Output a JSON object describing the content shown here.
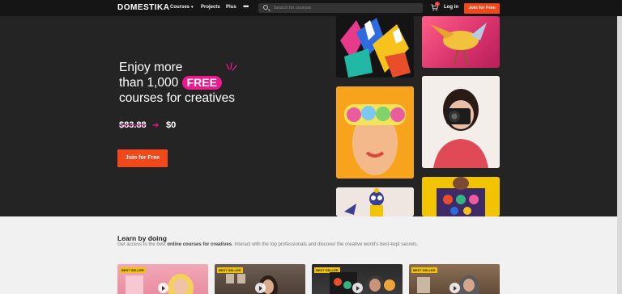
{
  "nav": {
    "logo": "DOMESTIKA",
    "courses_label": "Courses",
    "projects_label": "Projects",
    "plus_label": "Plus",
    "more_label": "•••",
    "search_placeholder": "Search for courses",
    "cart_count": "1",
    "login_label": "Log in",
    "join_label": "Join for Free"
  },
  "hero": {
    "headline_line1": "Enjoy more",
    "headline_line2_prefix": "than 1,000",
    "free_label": "FREE",
    "headline_line3": "courses for creatives",
    "price_old": "$83.88",
    "price_new": "$0",
    "join_label": "Join for Free"
  },
  "learn": {
    "title": "Learn by doing",
    "subtitle_prefix": "Get access to the best ",
    "subtitle_bold": "online courses for creatives",
    "subtitle_suffix": ". Interact with the top professionals and discover the creative world's best-kept secrets.",
    "cards": [
      {
        "badge": "BEST SELLER"
      },
      {
        "badge": "BEST SELLER"
      },
      {
        "badge": "BEST SELLER"
      },
      {
        "badge": "BEST SELLER"
      }
    ]
  },
  "colors": {
    "accent": "#f24718",
    "pink": "#f1178f",
    "nav_bg": "#151515",
    "hero_bg": "#242424"
  }
}
